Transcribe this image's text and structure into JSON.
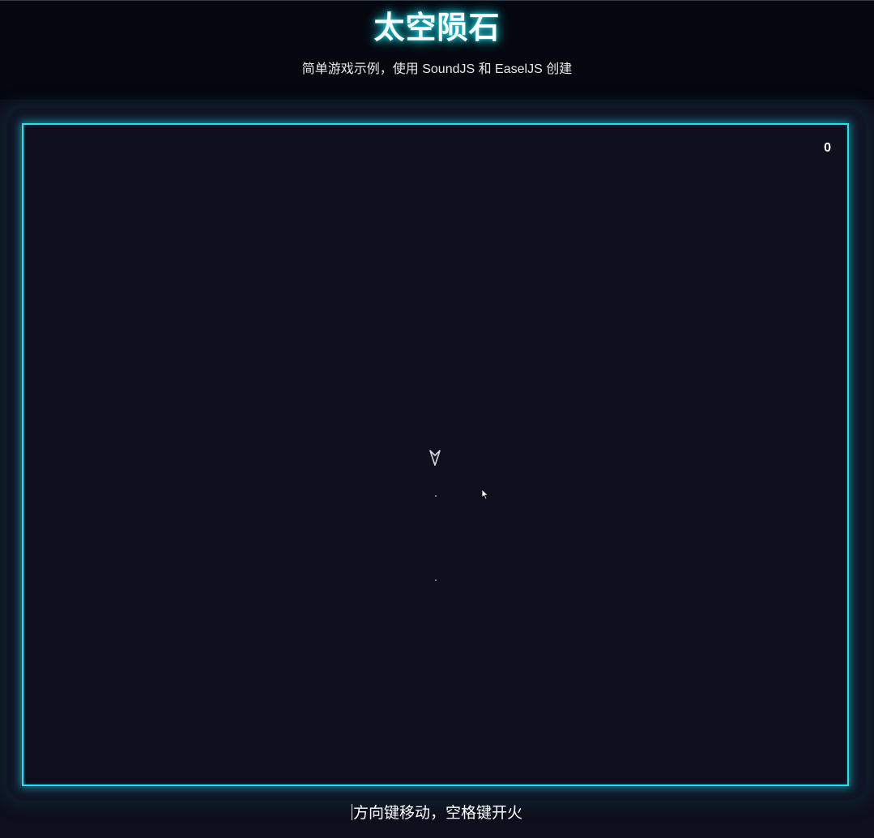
{
  "header": {
    "title": "太空陨石",
    "subtitle": "简单游戏示例，使用 SoundJS 和 EaselJS 创建"
  },
  "game": {
    "score": "0",
    "player_icon": "spaceship-icon",
    "bullet_count": 2
  },
  "footer": {
    "instructions": "方向键移动，空格键开火"
  },
  "colors": {
    "accent": "#1fe3ee",
    "background": "#0f0f1e",
    "header_background": "#05070e",
    "text": "#ffffff"
  }
}
